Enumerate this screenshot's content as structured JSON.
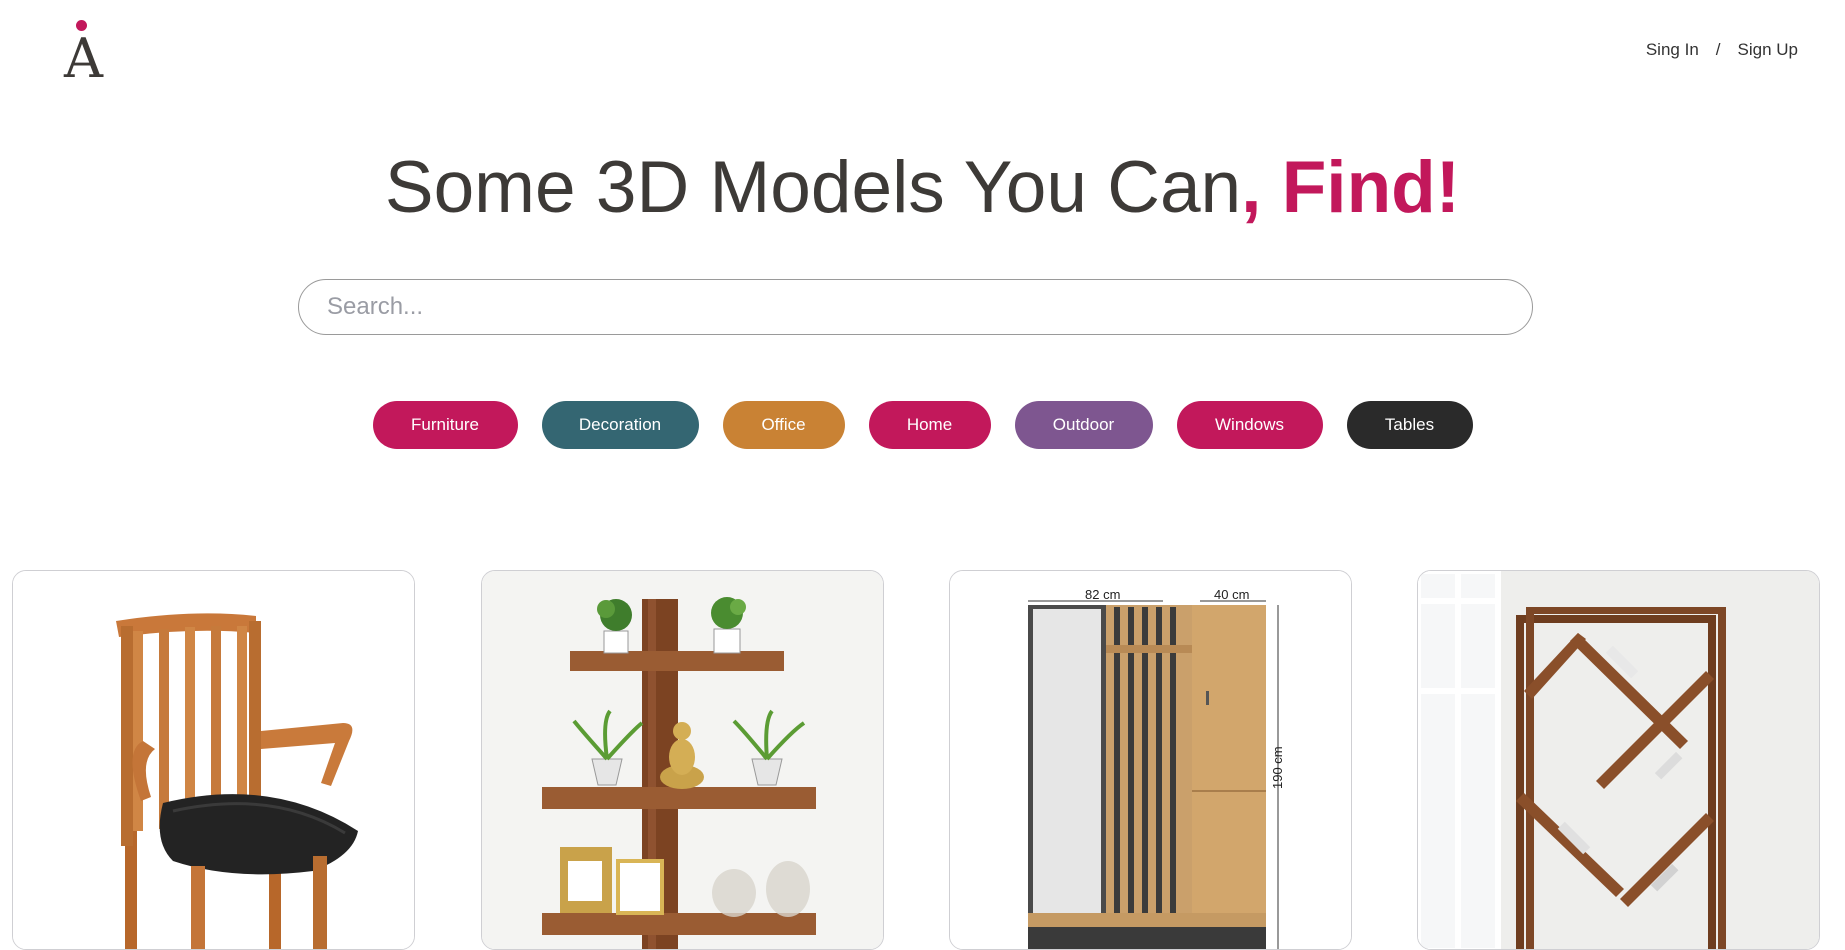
{
  "header": {
    "logo_letter": "A",
    "sign_in": "Sing In",
    "separator": "/",
    "sign_up": "Sign Up"
  },
  "hero": {
    "title_main": "Some 3D Models You Can",
    "title_accent": ", Find!"
  },
  "search": {
    "placeholder": "Search..."
  },
  "categories": [
    {
      "label": "Furniture",
      "color": "#c2185b"
    },
    {
      "label": "Decoration",
      "color": "#346672"
    },
    {
      "label": "Office",
      "color": "#c98234"
    },
    {
      "label": "Home",
      "color": "#c2185b"
    },
    {
      "label": "Outdoor",
      "color": "#7e5690"
    },
    {
      "label": "Windows",
      "color": "#c2185b"
    },
    {
      "label": "Tables",
      "color": "#2a2a2a"
    }
  ],
  "products": [
    {
      "icon": "wooden-chair-image"
    },
    {
      "icon": "plant-shelf-image"
    },
    {
      "icon": "hallway-wardrobe-image",
      "dimensions": {
        "width": "82 cm",
        "depth": "40 cm",
        "height": "190 cm"
      }
    },
    {
      "icon": "diagonal-bookshelf-image"
    }
  ],
  "colors": {
    "accent": "#c2185b",
    "text": "#3d3a37"
  }
}
